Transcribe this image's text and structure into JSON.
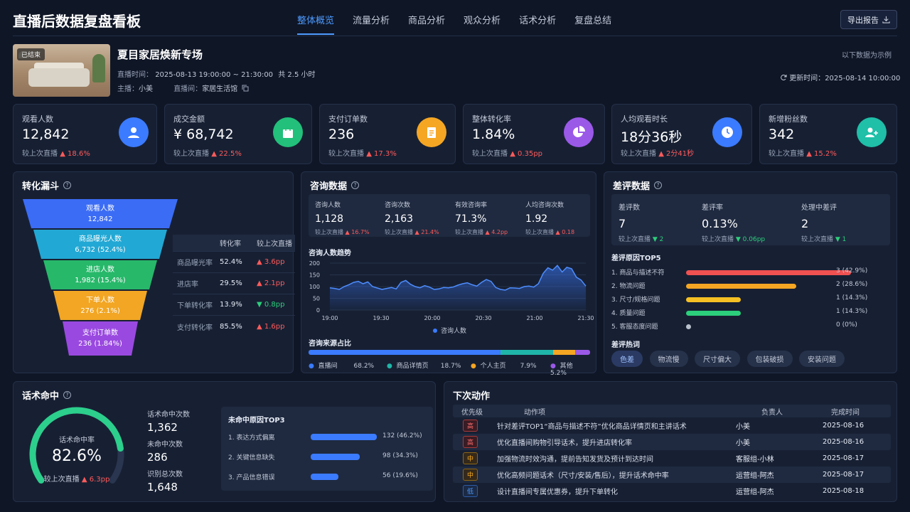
{
  "header": {
    "title": "直播后数据复盘看板",
    "tabs": [
      "整体概览",
      "流量分析",
      "商品分析",
      "观众分析",
      "话术分析",
      "复盘总结"
    ],
    "active_tab": 0,
    "export_label": "导出报告"
  },
  "live": {
    "status": "已结束",
    "title": "夏目家居焕新专场",
    "time_label": "直播时间：",
    "time_value": "2025-08-13 19:00:00 ~ 21:30:00",
    "duration": "共 2.5 小时",
    "host_label": "主播：",
    "host": "小美",
    "room_label": "直播间：",
    "room": "家居生活馆",
    "note": "以下数据为示例",
    "updated_label": "更新时间：",
    "updated": "2025-08-14 10:00:00"
  },
  "kpis": [
    {
      "label": "观看人数",
      "value": "12,842",
      "cmp_label": "较上次直播",
      "cmp": "▲ 18.6%",
      "icon": "user-icon",
      "color": "#3b7bff"
    },
    {
      "label": "成交金额",
      "value": "¥ 68,742",
      "cmp_label": "较上次直播",
      "cmp": "▲ 22.5%",
      "icon": "shopping-bag-icon",
      "color": "#22c07a"
    },
    {
      "label": "支付订单数",
      "value": "236",
      "cmp_label": "较上次直播",
      "cmp": "▲ 17.3%",
      "icon": "order-clipboard-icon",
      "color": "#f5a623"
    },
    {
      "label": "整体转化率",
      "value": "1.84%",
      "cmp_label": "较上次直播",
      "cmp": "▲ 0.35pp",
      "icon": "pie-chart-icon",
      "color": "#9b59e8"
    },
    {
      "label": "人均观看时长",
      "value": "18分36秒",
      "cmp_label": "较上次直播",
      "cmp": "▲ 2分41秒",
      "icon": "clock-icon",
      "color": "#3b7bff"
    },
    {
      "label": "新增粉丝数",
      "value": "342",
      "cmp_label": "较上次直播",
      "cmp": "▲ 15.2%",
      "icon": "add-user-icon",
      "color": "#1fbfa8"
    }
  ],
  "funnel": {
    "title": "转化漏斗",
    "stages": [
      {
        "name": "观看人数",
        "value": "12,842",
        "color": "#3b6cf5"
      },
      {
        "name": "商品曝光人数",
        "value": "6,732 (52.4%)",
        "color": "#22a8d4"
      },
      {
        "name": "进店人数",
        "value": "1,982 (15.4%)",
        "color": "#27b86a"
      },
      {
        "name": "下单人数",
        "value": "276 (2.1%)",
        "color": "#f2a623"
      },
      {
        "name": "支付订单数",
        "value": "236 (1.84%)",
        "color": "#9a49e0"
      }
    ],
    "table_headers": [
      "",
      "转化率",
      "较上次直播"
    ],
    "rows": [
      {
        "name": "商品曝光率",
        "rate": "52.4%",
        "cmp": "▲ 3.6pp",
        "dir": "up"
      },
      {
        "name": "进店率",
        "rate": "29.5%",
        "cmp": "▲ 2.1pp",
        "dir": "up"
      },
      {
        "name": "下单转化率",
        "rate": "13.9%",
        "cmp": "▼ 0.8pp",
        "dir": "down"
      },
      {
        "name": "支付转化率",
        "rate": "85.5%",
        "cmp": "▲ 1.6pp",
        "dir": "up"
      }
    ]
  },
  "consult": {
    "title": "咨询数据",
    "stats": [
      {
        "label": "咨询人数",
        "value": "1,128",
        "cmp_label": "较上次直播",
        "cmp": "▲ 16.7%"
      },
      {
        "label": "咨询次数",
        "value": "2,163",
        "cmp_label": "较上次直播",
        "cmp": "▲ 21.4%"
      },
      {
        "label": "有效咨询率",
        "value": "71.3%",
        "cmp_label": "较上次直播",
        "cmp": "▲ 4.2pp"
      },
      {
        "label": "人均咨询次数",
        "value": "1.92",
        "cmp_label": "较上次直播",
        "cmp": "▲ 0.18"
      }
    ],
    "trend_title": "咨询人数趋势",
    "source_title": "咨询来源占比",
    "sources": [
      {
        "name": "直播间",
        "pct": "68.2%",
        "value": 68.2,
        "color": "#3b7bff"
      },
      {
        "name": "商品详情页",
        "pct": "18.7%",
        "value": 18.7,
        "color": "#1fb5a8"
      },
      {
        "name": "个人主页",
        "pct": "7.9%",
        "value": 7.9,
        "color": "#f5a623"
      },
      {
        "name": "其他",
        "pct": "5.2%",
        "value": 5.2,
        "color": "#9b59e8"
      }
    ]
  },
  "chart_data": {
    "type": "area",
    "title": "咨询人数趋势",
    "series": [
      {
        "name": "咨询人数",
        "values": [
          95,
          92,
          88,
          100,
          108,
          118,
          122,
          112,
          120,
          100,
          94,
          88,
          92,
          96,
          90,
          118,
          126,
          110,
          100,
          95,
          104,
          98,
          88,
          90,
          96,
          95,
          98,
          106,
          112,
          116,
          108,
          102,
          118,
          130,
          122,
          96,
          88,
          85,
          95,
          94,
          92,
          100,
          102,
          98,
          112,
          156,
          180,
          170,
          190,
          162,
          182,
          176,
          140,
          128,
          102
        ]
      }
    ],
    "x_range": [
      "19:00",
      "21:30"
    ],
    "x_ticks": [
      "19:00",
      "19:30",
      "20:00",
      "20:30",
      "21:00",
      "21:30"
    ],
    "y_ticks": [
      "0",
      "50",
      "100",
      "150",
      "200"
    ],
    "ylim": [
      0,
      200
    ],
    "legend_position": "bottom"
  },
  "bad_reviews": {
    "title": "差评数据",
    "stats": [
      {
        "label": "差评数",
        "value": "7",
        "cmp_label": "较上次直播",
        "cmp": "▼ 2"
      },
      {
        "label": "差评率",
        "value": "0.13%",
        "cmp_label": "较上次直播",
        "cmp": "▼ 0.06pp"
      },
      {
        "label": "处理中差评",
        "value": "2",
        "cmp_label": "较上次直播",
        "cmp": "▼ 1"
      }
    ],
    "top_title": "差评原因TOP5",
    "reasons": [
      {
        "name": "1. 商品与描述不符",
        "count": "3 (42.9%)",
        "value": 3,
        "color": "#f05151"
      },
      {
        "name": "2. 物流问题",
        "count": "2 (28.6%)",
        "value": 2,
        "color": "#f5a623"
      },
      {
        "name": "3. 尺寸/规格问题",
        "count": "1 (14.3%)",
        "value": 1,
        "color": "#f5c023"
      },
      {
        "name": "4. 质量问题",
        "count": "1 (14.3%)",
        "value": 1,
        "color": "#2ccf7b"
      },
      {
        "name": "5. 客服态度问题",
        "count": "0 (0%)",
        "value": 0,
        "color": "#b8c0cc"
      }
    ],
    "hot_title": "差评热词",
    "hot_words": [
      "色差",
      "物流慢",
      "尺寸偏大",
      "包装破损",
      "安装问题"
    ]
  },
  "script_hit": {
    "title": "话术命中",
    "gauge_label": "话术命中率",
    "rate": "82.6%",
    "rate_value": 82.6,
    "cmp_label": "较上次直播",
    "cmp": "▲ 6.3pp",
    "stats": [
      {
        "label": "话术命中次数",
        "value": "1,362"
      },
      {
        "label": "未命中次数",
        "value": "286"
      },
      {
        "label": "识别总次数",
        "value": "1,648"
      }
    ],
    "miss_title": "未命中原因TOP3",
    "miss": [
      {
        "name": "1. 表达方式偏离",
        "count": "132 (46.2%)",
        "value": 132
      },
      {
        "name": "2. 关键信息缺失",
        "count": "98 (34.3%)",
        "value": 98
      },
      {
        "name": "3. 产品信息错误",
        "count": "56 (19.6%)",
        "value": 56
      }
    ]
  },
  "actions": {
    "title": "下次动作",
    "headers": [
      "优先级",
      "动作项",
      "负责人",
      "完成时间"
    ],
    "rows": [
      {
        "priority": "高",
        "level": "high",
        "item": "针对差评TOP1“商品与描述不符”优化商品详情页和主讲话术",
        "owner": "小美",
        "date": "2025-08-16"
      },
      {
        "priority": "高",
        "level": "high",
        "item": "优化直播间购物引导话术，提升进店转化率",
        "owner": "小美",
        "date": "2025-08-16"
      },
      {
        "priority": "中",
        "level": "mid",
        "item": "加强物流时效沟通，提前告知发货及预计到达时间",
        "owner": "客服组-小林",
        "date": "2025-08-17"
      },
      {
        "priority": "中",
        "level": "mid",
        "item": "优化高频问题话术（尺寸/安装/售后），提升话术命中率",
        "owner": "运营组-阿杰",
        "date": "2025-08-17"
      },
      {
        "priority": "低",
        "level": "low",
        "item": "设计直播间专属优惠券，提升下单转化",
        "owner": "运营组-阿杰",
        "date": "2025-08-18"
      }
    ]
  }
}
